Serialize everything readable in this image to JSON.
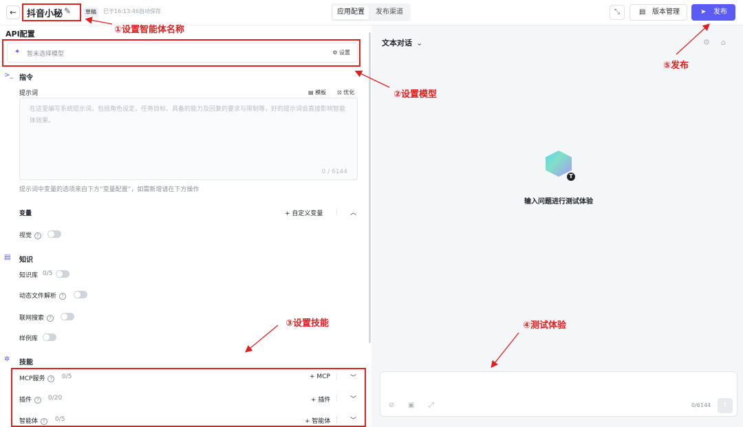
{
  "header": {
    "back_icon": "arrow-left-icon",
    "agent_name": "抖音小秘",
    "draft_badge": "草稿",
    "autosave": "已于16:13:46自动保存",
    "tabs": [
      {
        "label": "应用配置",
        "active": true
      },
      {
        "label": "发布渠道",
        "active": false
      }
    ],
    "version_label": "版本管理",
    "publish_label": "发布"
  },
  "left": {
    "api_title": "API配置",
    "model_placeholder": "暂未选择模型",
    "model_settings": "设置",
    "instruction": {
      "title": "指令",
      "prompt_label": "提示词",
      "template_link": "模板",
      "optimize_link": "优化",
      "prompt_placeholder": "在这里编写系统提示词，包括角色设定、任务目标、具备的能力及回复的要求与限制等，好的提示词会直接影响智能体效果。",
      "prompt_count": "0 / 6144",
      "hint": "提示词中变量的选项来自下方“变量配置”，如需新增请在下方操作"
    },
    "variables": {
      "title": "变量",
      "add_label": "+ 自定义变量"
    },
    "vision": {
      "label": "视觉",
      "enabled": false
    },
    "knowledge": {
      "title": "知识",
      "kb_label": "知识库",
      "kb_count": "0/5",
      "dynamic_label": "动态文件解析",
      "web_search_label": "联网搜索",
      "examples_label": "样例库"
    },
    "skills": {
      "title": "技能",
      "mcp": {
        "label": "MCP服务",
        "count": "0/5",
        "add": "+ MCP"
      },
      "plugins": {
        "label": "插件",
        "count": "0/20",
        "add": "+ 插件"
      },
      "agents": {
        "label": "智能体",
        "count": "0/5",
        "add": "+ 智能体"
      }
    }
  },
  "right": {
    "mode_label": "文本对话",
    "empty_text": "输入问题进行测试体验",
    "badge_letter": "T",
    "input_count": "0/6144"
  },
  "annotations": {
    "a1": "①设置智能体名称",
    "a2": "②设置模型",
    "a3": "③设置技能",
    "a4": "④测试体验",
    "a5": "⑤发布"
  },
  "colors": {
    "accent": "#5b5cf6",
    "annotation": "#e02020"
  }
}
